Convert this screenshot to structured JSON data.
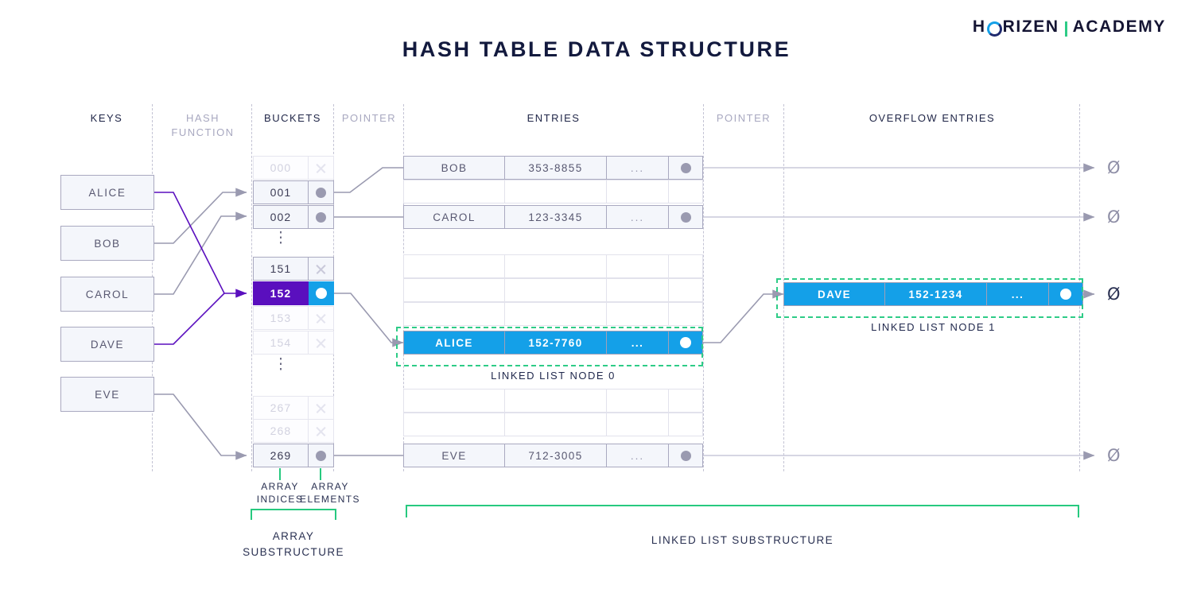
{
  "brand": {
    "part1": "H",
    "ring": "horizen-ring-icon",
    "part2": "RIZEN",
    "part3": "ACADEMY"
  },
  "title": "HASH TABLE DATA STRUCTURE",
  "columns": [
    {
      "id": "keys",
      "label": "KEYS"
    },
    {
      "id": "hash",
      "label": "HASH\nFUNCTION"
    },
    {
      "id": "buckets",
      "label": "BUCKETS"
    },
    {
      "id": "pointer1",
      "label": "POINTER"
    },
    {
      "id": "entries",
      "label": "ENTRIES"
    },
    {
      "id": "pointer2",
      "label": "POINTER"
    },
    {
      "id": "overflow",
      "label": "OVERFLOW ENTRIES"
    }
  ],
  "column_labels": {
    "keys": "KEYS",
    "hash_line1": "HASH",
    "hash_line2": "FUNCTION",
    "buckets": "BUCKETS",
    "pointer1": "POINTER",
    "entries": "ENTRIES",
    "pointer2": "POINTER",
    "overflow": "OVERFLOW ENTRIES"
  },
  "keys": [
    {
      "label": "ALICE",
      "maps_to": "152"
    },
    {
      "label": "BOB",
      "maps_to": "001"
    },
    {
      "label": "CAROL",
      "maps_to": "002"
    },
    {
      "label": "DAVE",
      "maps_to": "152"
    },
    {
      "label": "EVE",
      "maps_to": "269"
    }
  ],
  "buckets": [
    {
      "index": "000",
      "state": "empty",
      "marker": "x-icon",
      "faded": true
    },
    {
      "index": "001",
      "state": "filled",
      "marker": "dot-icon",
      "faded": false
    },
    {
      "index": "002",
      "state": "filled",
      "marker": "dot-icon",
      "faded": false
    },
    {
      "index": "151",
      "state": "empty",
      "marker": "x-icon",
      "faded": false
    },
    {
      "index": "152",
      "state": "filled",
      "marker": "dot-icon",
      "faded": false,
      "highlight": true
    },
    {
      "index": "153",
      "state": "empty",
      "marker": "x-icon",
      "faded": true
    },
    {
      "index": "154",
      "state": "empty",
      "marker": "x-icon",
      "faded": true
    },
    {
      "index": "267",
      "state": "empty",
      "marker": "x-icon",
      "faded": true
    },
    {
      "index": "268",
      "state": "empty",
      "marker": "x-icon",
      "faded": true
    },
    {
      "index": "269",
      "state": "filled",
      "marker": "dot-icon",
      "faded": false
    }
  ],
  "ellipsis": "⋮",
  "entries": [
    {
      "name": "BOB",
      "phone": "353-8855",
      "more": "...",
      "pointer": "dot-icon",
      "style": "normal"
    },
    {
      "name": "CAROL",
      "phone": "123-3345",
      "more": "...",
      "pointer": "dot-icon",
      "style": "normal"
    },
    {
      "name": "ALICE",
      "phone": "152-7760",
      "more": "...",
      "pointer": "dot-white-icon",
      "style": "highlight"
    },
    {
      "name": "EVE",
      "phone": "712-3005",
      "more": "...",
      "pointer": "dot-icon",
      "style": "normal"
    }
  ],
  "overflow_entries": [
    {
      "name": "DAVE",
      "phone": "152-1234",
      "more": "...",
      "pointer": "dot-white-icon",
      "style": "highlight"
    }
  ],
  "node_labels": {
    "node0": "LINKED LIST NODE 0",
    "node1": "LINKED LIST NODE 1"
  },
  "annotations": {
    "array_indices": "ARRAY\nINDICES",
    "array_indices_l1": "ARRAY",
    "array_indices_l2": "INDICES",
    "array_elements_l1": "ARRAY",
    "array_elements_l2": "ELEMENTS",
    "array_substructure_l1": "ARRAY",
    "array_substructure_l2": "SUBSTRUCTURE",
    "linked_list_substructure": "LINKED LIST SUBSTRUCTURE"
  },
  "null_symbol": "Ø",
  "null_terminators": [
    {
      "for": "BOB",
      "emphasis": "normal"
    },
    {
      "for": "CAROL",
      "emphasis": "normal"
    },
    {
      "for": "DAVE",
      "emphasis": "dark"
    },
    {
      "for": "EVE",
      "emphasis": "normal"
    }
  ],
  "colors": {
    "accent_purple": "#5a0fbe",
    "accent_blue": "#14a0e8",
    "accent_green": "#2ecc87",
    "ink": "#131a3e",
    "muted": "#a8a8c0",
    "line": "#a9a9c0"
  }
}
